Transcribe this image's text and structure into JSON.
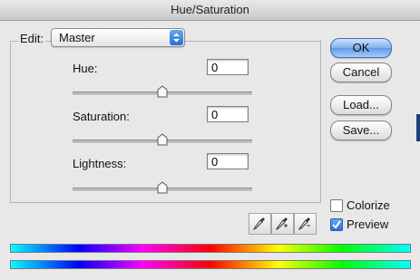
{
  "window": {
    "title": "Hue/Saturation"
  },
  "edit": {
    "label": "Edit:",
    "selected": "Master"
  },
  "hue": {
    "label": "Hue:",
    "value": "0"
  },
  "saturation": {
    "label": "Saturation:",
    "value": "0"
  },
  "lightness": {
    "label": "Lightness:",
    "value": "0"
  },
  "buttons": {
    "ok": "OK",
    "cancel": "Cancel",
    "load": "Load...",
    "save": "Save..."
  },
  "options": {
    "colorize": {
      "label": "Colorize",
      "checked": false
    },
    "preview": {
      "label": "Preview",
      "checked": true
    }
  },
  "icons": {
    "eyedropper": "eyedropper-icon",
    "eyedropper_plus": "eyedropper-plus-icon",
    "eyedropper_minus": "eyedropper-minus-icon"
  },
  "colors": {
    "accent": "#2a6fd7"
  }
}
